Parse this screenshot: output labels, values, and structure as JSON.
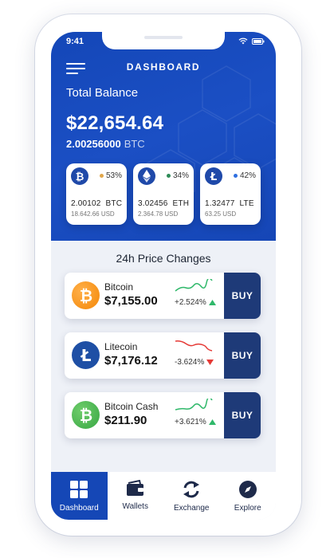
{
  "status": {
    "time": "9:41"
  },
  "header": {
    "title": "DASHBOARD"
  },
  "balance": {
    "label": "Total Balance",
    "usd": "$22,654.64",
    "btc_amount": "2.00256000",
    "btc_unit": "BTC"
  },
  "wallets": [
    {
      "coin": "bitcoin",
      "icon": "bitcoin-icon",
      "percent": "53%",
      "dot_color": "#e0a64a",
      "amount": "2.00102",
      "unit": "BTC",
      "usd": "18.642.66 USD"
    },
    {
      "coin": "ethereum",
      "icon": "ethereum-icon",
      "percent": "34%",
      "dot_color": "#2e8b57",
      "amount": "3.02456",
      "unit": "ETH",
      "usd": "2.364.78 USD"
    },
    {
      "coin": "litecoin",
      "icon": "litecoin-icon",
      "percent": "42%",
      "dot_color": "#2f6fe0",
      "amount": "1.32477",
      "unit": "LTE",
      "usd": "63.25 USD"
    }
  ],
  "prices": {
    "title": "24h Price Changes",
    "items": [
      {
        "name": "Bitcoin",
        "price": "$7,155.00",
        "change": "+2.524%",
        "direction": "up",
        "logo_color": "#f7931a",
        "buy_label": "BUY"
      },
      {
        "name": "Litecoin",
        "price": "$7,176.12",
        "change": "-3.624%",
        "direction": "down",
        "logo_color": "#1e4fa5",
        "buy_label": "BUY"
      },
      {
        "name": "Bitcoin Cash",
        "price": "$211.90",
        "change": "+3.621%",
        "direction": "up",
        "logo_color": "#48b24f",
        "buy_label": "BUY"
      }
    ]
  },
  "tabs": [
    {
      "label": "Dashboard",
      "icon": "grid-icon",
      "active": true
    },
    {
      "label": "Wallets",
      "icon": "wallet-icon",
      "active": false
    },
    {
      "label": "Exchange",
      "icon": "exchange-icon",
      "active": false
    },
    {
      "label": "Explore",
      "icon": "compass-icon",
      "active": false
    }
  ],
  "colors": {
    "primary": "#1547b6",
    "buy_button": "#1e3a78",
    "up": "#2fb86a",
    "down": "#e53935"
  }
}
